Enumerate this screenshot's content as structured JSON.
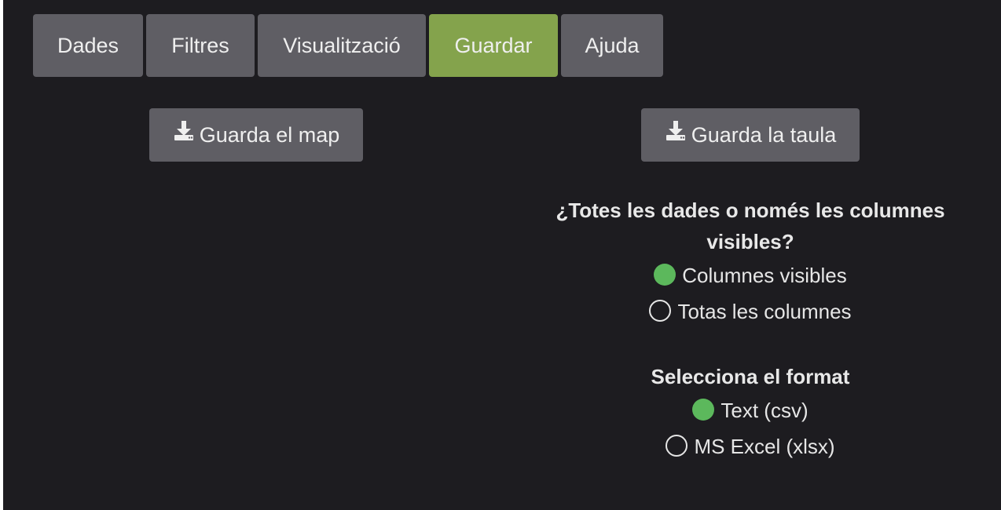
{
  "tabs": [
    {
      "label": "Dades"
    },
    {
      "label": "Filtres"
    },
    {
      "label": "Visualització"
    },
    {
      "label": "Guardar"
    },
    {
      "label": "Ajuda"
    }
  ],
  "active_tab": "Guardar",
  "save_map_button": {
    "label": "Guarda el map",
    "icon": "download-icon"
  },
  "save_table_button": {
    "label": "Guarda la taula",
    "icon": "download-icon"
  },
  "columns_question": "¿Totes les dades o només les columnes visibles?",
  "columns_options": [
    {
      "label": "Columnes visibles",
      "checked": true
    },
    {
      "label": "Totas les columnes",
      "checked": false
    }
  ],
  "format_title": "Selecciona el format",
  "format_options": [
    {
      "label": "Text (csv)",
      "checked": true
    },
    {
      "label": "MS Excel (xlsx)",
      "checked": false
    }
  ],
  "colors": {
    "background": "#1d1c20",
    "tab": "#5f5e64",
    "tab_active": "#84a34c",
    "radio_checked": "#5cb85c"
  }
}
